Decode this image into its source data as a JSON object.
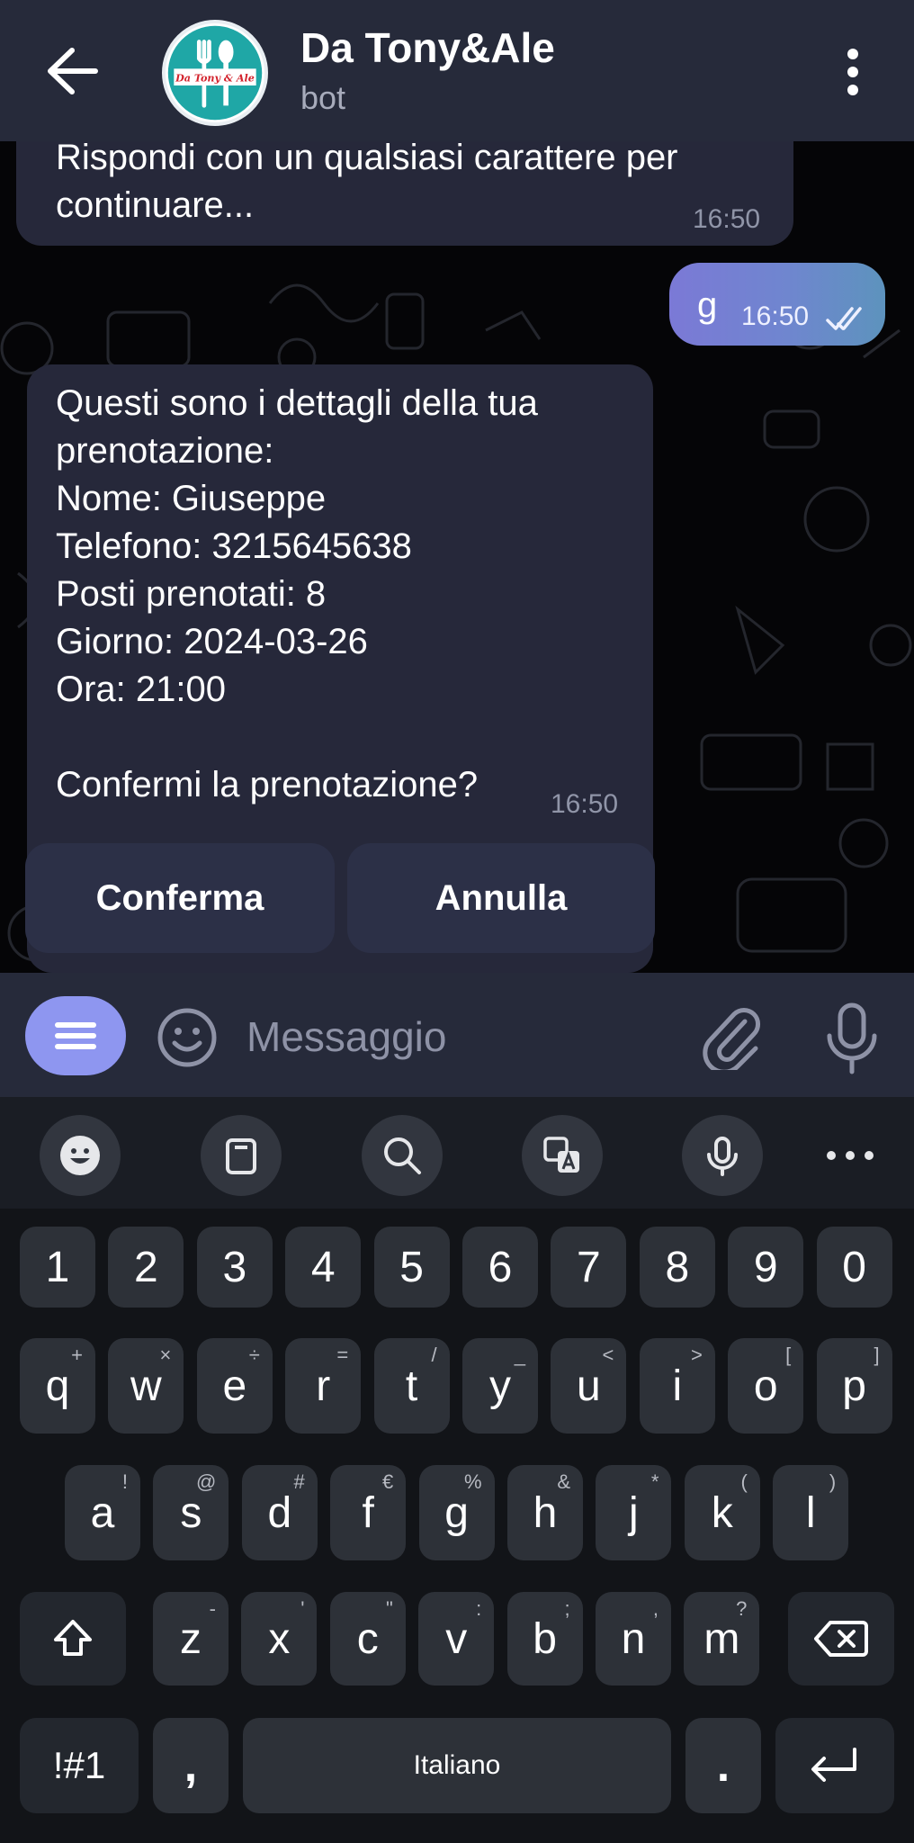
{
  "header": {
    "title": "Da Tony&Ale",
    "subtitle": "bot",
    "avatar_text": "Da Tony & Ale"
  },
  "messages": [
    {
      "dir": "in",
      "text": "Rispondi con un qualsiasi carattere per\ncontinuare...",
      "time": "16:50"
    },
    {
      "dir": "out",
      "text": "g",
      "time": "16:50"
    },
    {
      "dir": "in",
      "text": "Questi sono i dettagli della tua\nprenotazione:\nNome: Giuseppe\nTelefono: 3215645638\nPosti prenotati: 8\nGiorno: 2024-03-26\nOra: 21:00\n\nConfermi la prenotazione?",
      "time": "16:50"
    }
  ],
  "inline_keyboard": {
    "confirm": "Conferma",
    "cancel": "Annulla"
  },
  "input": {
    "placeholder": "Messaggio"
  },
  "keyboard": {
    "toolbar": [
      "emoji-icon",
      "clipboard-icon",
      "search-icon",
      "translate-icon",
      "mic-icon",
      "more-icon"
    ],
    "numbers": [
      "1",
      "2",
      "3",
      "4",
      "5",
      "6",
      "7",
      "8",
      "9",
      "0"
    ],
    "row1": [
      "q",
      "w",
      "e",
      "r",
      "t",
      "y",
      "u",
      "i",
      "o",
      "p"
    ],
    "row1_sup": [
      "+",
      "×",
      "÷",
      "=",
      "/",
      "_",
      "<",
      ">",
      "[",
      "]"
    ],
    "row2": [
      "a",
      "s",
      "d",
      "f",
      "g",
      "h",
      "j",
      "k",
      "l"
    ],
    "row2_sup": [
      "!",
      "@",
      "#",
      "€",
      "%",
      "&",
      "*",
      "(",
      ")"
    ],
    "row3": [
      "z",
      "x",
      "c",
      "v",
      "b",
      "n",
      "m"
    ],
    "row3_sup": [
      "-",
      "'",
      "\"",
      ":",
      ";",
      ",",
      "?"
    ],
    "symbols_key": "!#1",
    "comma_key": ",",
    "space_label": "Italiano",
    "period_key": "."
  },
  "colors": {
    "header": "#262a3a",
    "bubble_in": "#26283a",
    "bubble_out_start": "#7b79d6",
    "accent": "#8e96f0",
    "chat_bg": "#050507"
  }
}
